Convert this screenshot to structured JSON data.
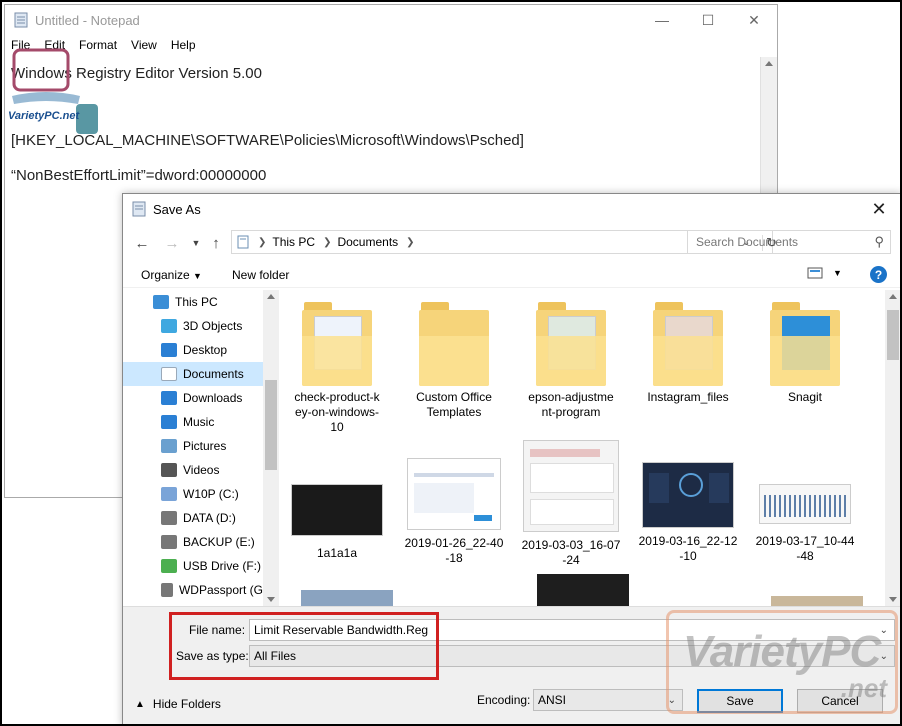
{
  "notepad": {
    "title": "Untitled - Notepad",
    "menu": [
      "File",
      "Edit",
      "Format",
      "View",
      "Help"
    ],
    "lines": [
      "Windows Registry Editor Version 5.00",
      "[HKEY_LOCAL_MACHINE\\SOFTWARE\\Policies\\Microsoft\\Windows\\Psched]",
      "“NonBestEffortLimit”=dword:00000000"
    ]
  },
  "watermark_top": "VarietyPC.net",
  "watermark_bottom": {
    "main": "VarietyPC",
    "sub": ".net"
  },
  "dialog": {
    "title": "Save As",
    "breadcrumbs": [
      "This PC",
      "Documents"
    ],
    "search_placeholder": "Search Documents",
    "toolbar": {
      "organize": "Organize",
      "new_folder": "New folder",
      "help": "?"
    },
    "tree": [
      {
        "label": "This PC",
        "icon": "pc-icon",
        "indent": 0,
        "color": "#3b8ed6"
      },
      {
        "label": "3D Objects",
        "icon": "cube-icon",
        "indent": 1,
        "color": "#3fa8e0"
      },
      {
        "label": "Desktop",
        "icon": "desktop-icon",
        "indent": 1,
        "color": "#2a7fd4"
      },
      {
        "label": "Documents",
        "icon": "document-icon",
        "indent": 1,
        "color": "#9aa9b9",
        "selected": true
      },
      {
        "label": "Downloads",
        "icon": "download-icon",
        "indent": 1,
        "color": "#2a7fd4"
      },
      {
        "label": "Music",
        "icon": "music-icon",
        "indent": 1,
        "color": "#2a7fd4"
      },
      {
        "label": "Pictures",
        "icon": "pictures-icon",
        "indent": 1,
        "color": "#6aa0cf"
      },
      {
        "label": "Videos",
        "icon": "videos-icon",
        "indent": 1,
        "color": "#555"
      },
      {
        "label": "W10P (C:)",
        "icon": "drive-os-icon",
        "indent": 1,
        "color": "#7aa4d8"
      },
      {
        "label": "DATA (D:)",
        "icon": "drive-icon",
        "indent": 1,
        "color": "#777"
      },
      {
        "label": "BACKUP (E:)",
        "icon": "drive-icon",
        "indent": 1,
        "color": "#777"
      },
      {
        "label": "USB Drive (F:)",
        "icon": "usb-drive-icon",
        "indent": 1,
        "color": "#4caf50"
      },
      {
        "label": "WDPassport (G",
        "icon": "drive-icon",
        "indent": 1,
        "color": "#777"
      }
    ],
    "folders": [
      {
        "name": "check-product-k\ney-on-windows-\n10"
      },
      {
        "name": "Custom Office\nTemplates"
      },
      {
        "name": "epson-adjustme\nnt-program"
      },
      {
        "name": "Instagram_files"
      },
      {
        "name": "Snagit"
      }
    ],
    "images": [
      {
        "name": "1a1a1a",
        "color": "#1a1a1a"
      },
      {
        "name": "2019-01-26_22-40\n-18",
        "color": "#ffffff"
      },
      {
        "name": "2019-03-03_16-07\n-24",
        "color": "#f4f4f4"
      },
      {
        "name": "2019-03-16_22-12\n-10",
        "color": "#1d2b45"
      },
      {
        "name": "2019-03-17_10-44\n-48",
        "color": "#f7f7f7"
      }
    ],
    "file_name_label": "File name:",
    "file_name_value": "Limit Reservable Bandwidth.Reg",
    "save_type_label": "Save as type:",
    "save_type_value": "All Files",
    "hide_folders": "Hide Folders",
    "encoding_label": "Encoding:",
    "encoding_value": "ANSI",
    "save_button": "Save",
    "cancel_button": "Cancel",
    "accent_color": "#0078d7",
    "highlight_color": "#d02020"
  }
}
